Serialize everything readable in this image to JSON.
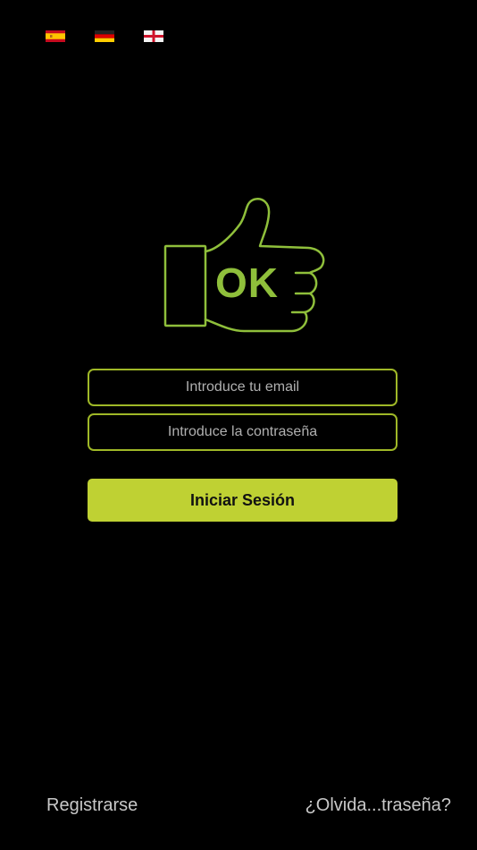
{
  "languages": {
    "items": [
      {
        "code": "es",
        "icon": "spain-flag-icon"
      },
      {
        "code": "de",
        "icon": "germany-flag-icon"
      },
      {
        "code": "en",
        "icon": "england-flag-icon"
      }
    ]
  },
  "logo": {
    "text": "OK",
    "icon": "thumbs-up-icon",
    "color": "#8fbf3b"
  },
  "login_form": {
    "email_placeholder": "Introduce tu email",
    "email_value": "",
    "password_placeholder": "Introduce la contraseña",
    "password_value": "",
    "submit_label": "Iniciar Sesión"
  },
  "footer": {
    "register_label": "Registrarse",
    "forgot_password_label": "¿Olvida...traseña?"
  },
  "colors": {
    "background": "#000000",
    "accent": "#bfd133",
    "field_border": "#9fb827",
    "text": "#c8c8c8"
  }
}
